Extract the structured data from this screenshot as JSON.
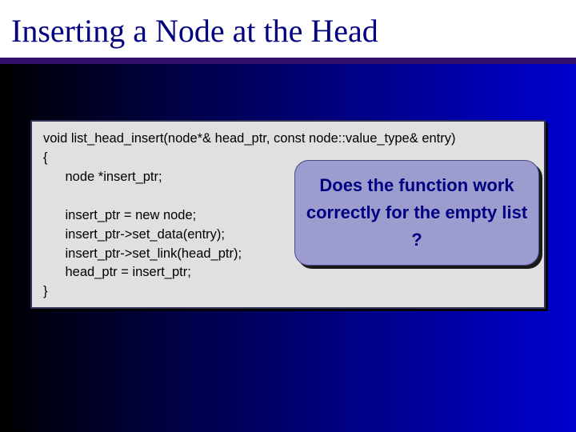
{
  "slide": {
    "title": "Inserting a Node at the Head"
  },
  "code": {
    "line1": "void list_head_insert(node*& head_ptr, const node::value_type& entry)",
    "line2": "{",
    "line3": "      node *insert_ptr;",
    "line4": "",
    "line5": "      insert_ptr = new node;",
    "line6": "      insert_ptr->set_data(entry);",
    "line7": "      insert_ptr->set_link(head_ptr);",
    "line8": "      head_ptr = insert_ptr;",
    "line9": "}"
  },
  "callout": {
    "text": "Does the function work correctly for the empty list ?"
  }
}
